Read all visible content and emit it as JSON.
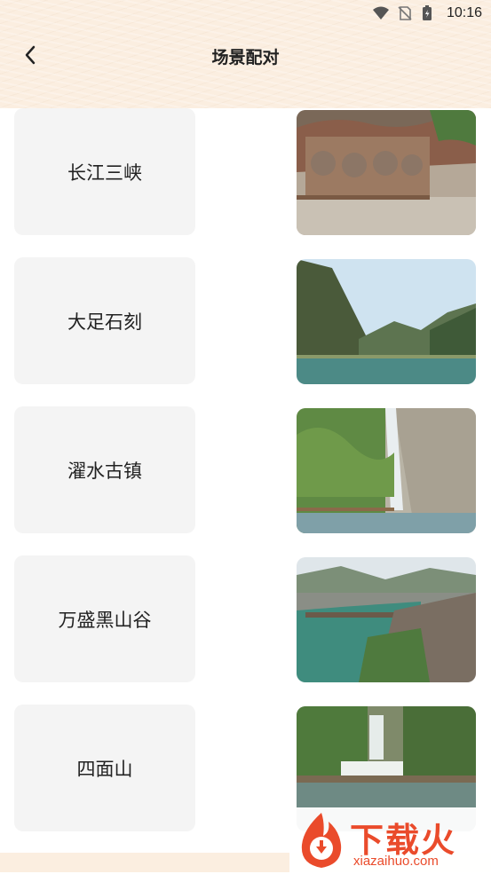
{
  "status_bar": {
    "time": "10:16"
  },
  "header": {
    "title": "场景配对"
  },
  "rows": [
    {
      "label": "长江三峡"
    },
    {
      "label": "大足石刻"
    },
    {
      "label": "濯水古镇"
    },
    {
      "label": "万盛黑山谷"
    },
    {
      "label": "四面山"
    }
  ],
  "watermark": {
    "chinese": "下载火",
    "domain": "xiazaihuo.com"
  }
}
